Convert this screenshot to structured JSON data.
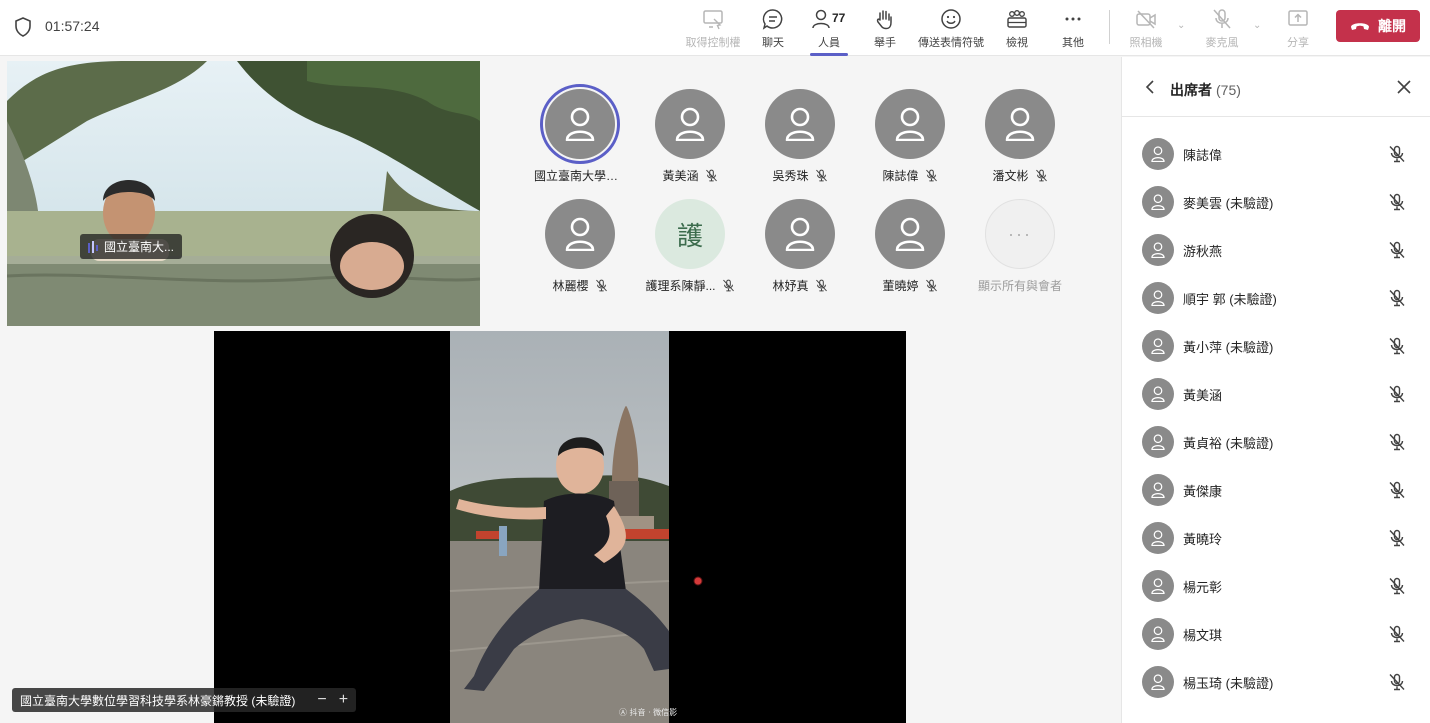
{
  "header": {
    "timer": "01:57:24",
    "buttons": {
      "take_control": "取得控制權",
      "chat": "聊天",
      "people": "人員",
      "people_count": "77",
      "raise_hand": "舉手",
      "react": "傳送表情符號",
      "view": "檢視",
      "more": "其他",
      "camera": "照相機",
      "mic": "麥克風",
      "share": "分享"
    },
    "leave_label": "離開"
  },
  "camera_tile": {
    "name": "國立臺南大..."
  },
  "gallery": [
    {
      "name": "國立臺南大學數...",
      "muted": false,
      "speaking": true
    },
    {
      "name": "黃美涵",
      "muted": true
    },
    {
      "name": "吳秀珠",
      "muted": true
    },
    {
      "name": "陳誌偉",
      "muted": true
    },
    {
      "name": "潘文彬",
      "muted": true
    },
    {
      "name": "林麗櫻",
      "muted": true
    },
    {
      "name": "護理系陳靜...",
      "muted": true,
      "initial": "護"
    },
    {
      "name": "林妤真",
      "muted": true
    },
    {
      "name": "董曉婷",
      "muted": true
    },
    {
      "name": "顯示所有與會者",
      "more": true
    }
  ],
  "share": {
    "presenter": "國立臺南大學數位學習科技學系林豪鏘教授 (未驗證)",
    "watermark": "Ⓐ 抖音 · 微信影"
  },
  "panel": {
    "title": "出席者",
    "count": "(75)",
    "attendees": [
      "陳誌偉",
      "麥美雲 (未驗證)",
      "游秋燕",
      "順宇 郭 (未驗證)",
      "黃小萍 (未驗證)",
      "黃美涵",
      "黃貞裕 (未驗證)",
      "黃傑康",
      "黃曉玲",
      "楊元彰",
      "楊文琪",
      "楊玉琦 (未驗證)"
    ]
  },
  "colors": {
    "accent": "#5b5fc7",
    "leave": "#c4314b",
    "avatar": "#8a8a8a"
  }
}
